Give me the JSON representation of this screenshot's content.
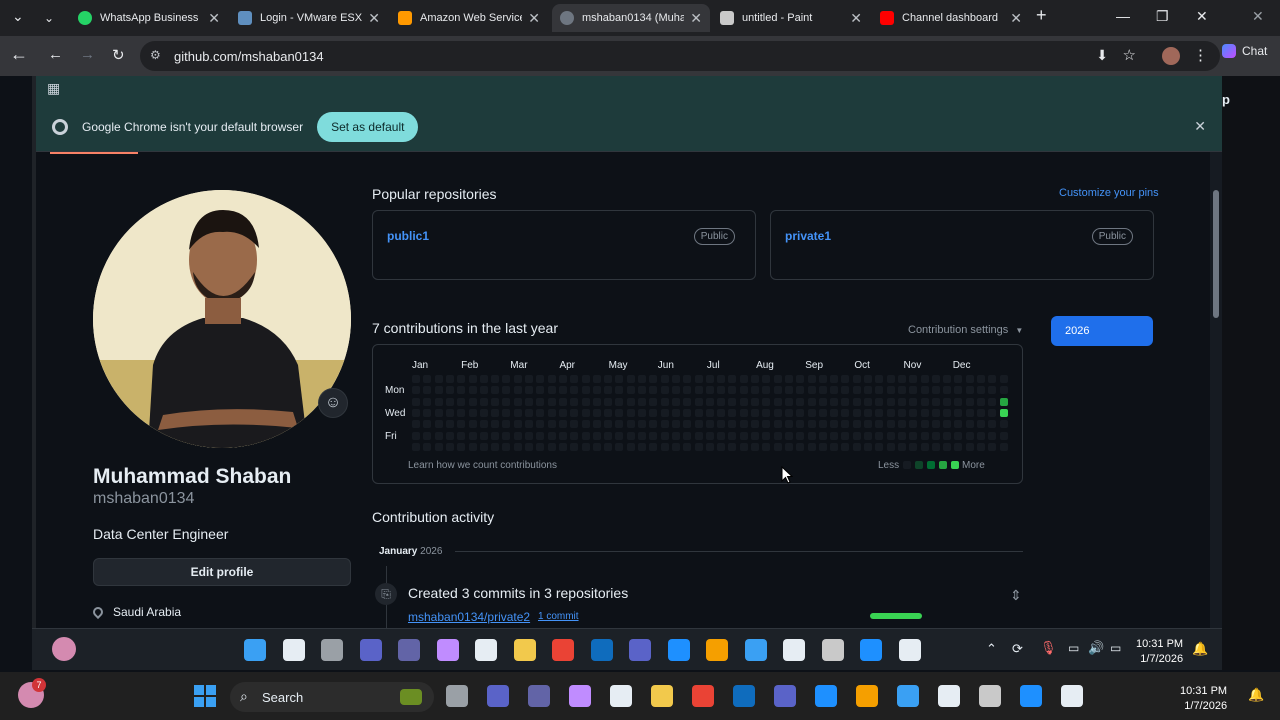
{
  "tabs": [
    {
      "title": "WhatsApp Business",
      "color": "#25d366"
    },
    {
      "title": "Login - VMware ESXi",
      "color": "#5f8fbf"
    },
    {
      "title": "Amazon Web Service",
      "color": "#ff9900"
    },
    {
      "title": "mshaban0134 (Muha",
      "color": "#6e7681"
    },
    {
      "title": "untitled - Paint",
      "color": "#c9c9c9"
    },
    {
      "title": "Channel dashboard",
      "color": "#ff0000"
    }
  ],
  "browser": {
    "url": "github.com/mshaban0134",
    "chat_label": "Chat"
  },
  "infobar": {
    "message": "Google Chrome isn't your default browser",
    "button": "Set as default"
  },
  "profile": {
    "name": "Muhammad Shaban",
    "login": "mshaban0134",
    "bio": "Data Center Engineer",
    "edit_button": "Edit profile",
    "location": "Saudi Arabia"
  },
  "popular": {
    "title": "Popular repositories",
    "customize": "Customize your pins",
    "repos": [
      {
        "name": "public1",
        "visibility": "Public"
      },
      {
        "name": "private1",
        "visibility": "Public"
      }
    ]
  },
  "contributions": {
    "summary": "7 contributions in the last year",
    "settings": "Contribution settings",
    "year": "2026",
    "months": [
      "Jan",
      "Feb",
      "Mar",
      "Apr",
      "May",
      "Jun",
      "Jul",
      "Aug",
      "Sep",
      "Oct",
      "Nov",
      "Dec"
    ],
    "weekdays": [
      "Mon",
      "Wed",
      "Fri"
    ],
    "learn": "Learn how we count contributions",
    "less": "Less",
    "more": "More",
    "active_cells": [
      {
        "week": 52,
        "day": 2,
        "level": 3
      },
      {
        "week": 52,
        "day": 3,
        "level": 4
      }
    ],
    "level_colors": [
      "#161b22",
      "#0e4429",
      "#006d32",
      "#26a641",
      "#39d353"
    ]
  },
  "activity": {
    "title": "Contribution activity",
    "month": "January",
    "year": "2026",
    "event": "Created 3 commits in 3 repositories",
    "repo": "mshaban0134/private2",
    "commits": "1 commit"
  },
  "taskbar": {
    "search": "Search",
    "time": "10:31 PM",
    "date": "1/7/2026",
    "notification_count": "7"
  }
}
